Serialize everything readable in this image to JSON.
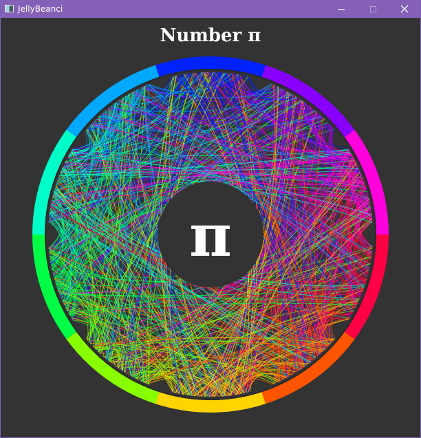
{
  "window": {
    "title": "JellyBeanci",
    "icon": "app-window-icon",
    "controls": [
      "minimize-icon",
      "maximize-icon",
      "close-icon"
    ]
  },
  "heading": "Number π",
  "center_symbol": "π",
  "visualization": {
    "kind": "digit chord diagram of pi",
    "palette": [
      "#ff0044",
      "#ff5500",
      "#ffd400",
      "#88ff00",
      "#00ff44",
      "#00ffc8",
      "#00a8ff",
      "#0022ff",
      "#8800ff",
      "#ff00dd"
    ],
    "background": "#333333"
  }
}
